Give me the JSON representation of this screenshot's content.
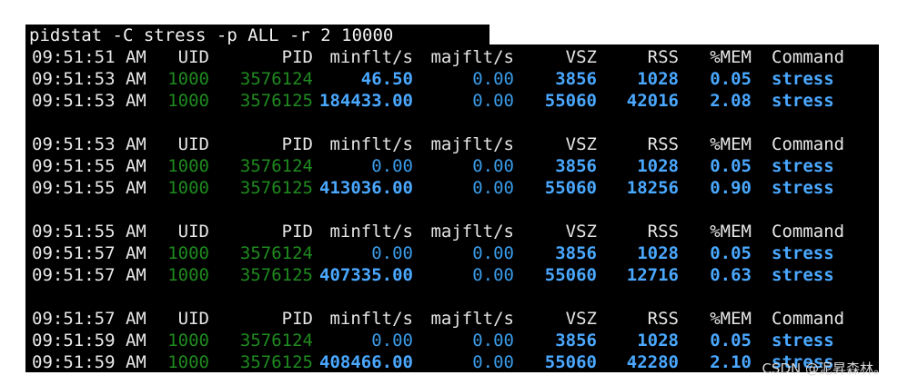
{
  "colors": {
    "terminal_bg": "#000000",
    "text": "#e6e6e6",
    "green": "#1f8a1f",
    "blue": "#3a9be8",
    "blue_bold": "#4aa8ff"
  },
  "command_line": "pidstat -C stress -p ALL -r 2 10000",
  "blocks": [
    {
      "header": {
        "time": "09:51:51 AM",
        "uid": "UID",
        "pid": "PID",
        "minflt": "minflt/s",
        "majflt": "majflt/s",
        "vsz": "VSZ",
        "rss": "RSS",
        "mem": "%MEM",
        "command": "Command"
      },
      "rows": [
        {
          "time": "09:51:53 AM",
          "uid": "1000",
          "pid": "3576124",
          "minflt": "46.50",
          "majflt": "0.00",
          "vsz": "3856",
          "rss": "1028",
          "mem": "0.05",
          "command": "stress"
        },
        {
          "time": "09:51:53 AM",
          "uid": "1000",
          "pid": "3576125",
          "minflt": "184433.00",
          "majflt": "0.00",
          "vsz": "55060",
          "rss": "42016",
          "mem": "2.08",
          "command": "stress"
        }
      ]
    },
    {
      "header": {
        "time": "09:51:53 AM",
        "uid": "UID",
        "pid": "PID",
        "minflt": "minflt/s",
        "majflt": "majflt/s",
        "vsz": "VSZ",
        "rss": "RSS",
        "mem": "%MEM",
        "command": "Command"
      },
      "rows": [
        {
          "time": "09:51:55 AM",
          "uid": "1000",
          "pid": "3576124",
          "minflt": "0.00",
          "majflt": "0.00",
          "vsz": "3856",
          "rss": "1028",
          "mem": "0.05",
          "command": "stress"
        },
        {
          "time": "09:51:55 AM",
          "uid": "1000",
          "pid": "3576125",
          "minflt": "413036.00",
          "majflt": "0.00",
          "vsz": "55060",
          "rss": "18256",
          "mem": "0.90",
          "command": "stress"
        }
      ]
    },
    {
      "header": {
        "time": "09:51:55 AM",
        "uid": "UID",
        "pid": "PID",
        "minflt": "minflt/s",
        "majflt": "majflt/s",
        "vsz": "VSZ",
        "rss": "RSS",
        "mem": "%MEM",
        "command": "Command"
      },
      "rows": [
        {
          "time": "09:51:57 AM",
          "uid": "1000",
          "pid": "3576124",
          "minflt": "0.00",
          "majflt": "0.00",
          "vsz": "3856",
          "rss": "1028",
          "mem": "0.05",
          "command": "stress"
        },
        {
          "time": "09:51:57 AM",
          "uid": "1000",
          "pid": "3576125",
          "minflt": "407335.00",
          "majflt": "0.00",
          "vsz": "55060",
          "rss": "12716",
          "mem": "0.63",
          "command": "stress"
        }
      ]
    },
    {
      "header": {
        "time": "09:51:57 AM",
        "uid": "UID",
        "pid": "PID",
        "minflt": "minflt/s",
        "majflt": "majflt/s",
        "vsz": "VSZ",
        "rss": "RSS",
        "mem": "%MEM",
        "command": "Command"
      },
      "rows": [
        {
          "time": "09:51:59 AM",
          "uid": "1000",
          "pid": "3576124",
          "minflt": "0.00",
          "majflt": "0.00",
          "vsz": "3856",
          "rss": "1028",
          "mem": "0.05",
          "command": "stress"
        },
        {
          "time": "09:51:59 AM",
          "uid": "1000",
          "pid": "3576125",
          "minflt": "408466.00",
          "majflt": "0.00",
          "vsz": "55060",
          "rss": "42280",
          "mem": "2.10",
          "command": "stress"
        }
      ]
    }
  ],
  "watermark": "CSDN @泥昇森林。"
}
